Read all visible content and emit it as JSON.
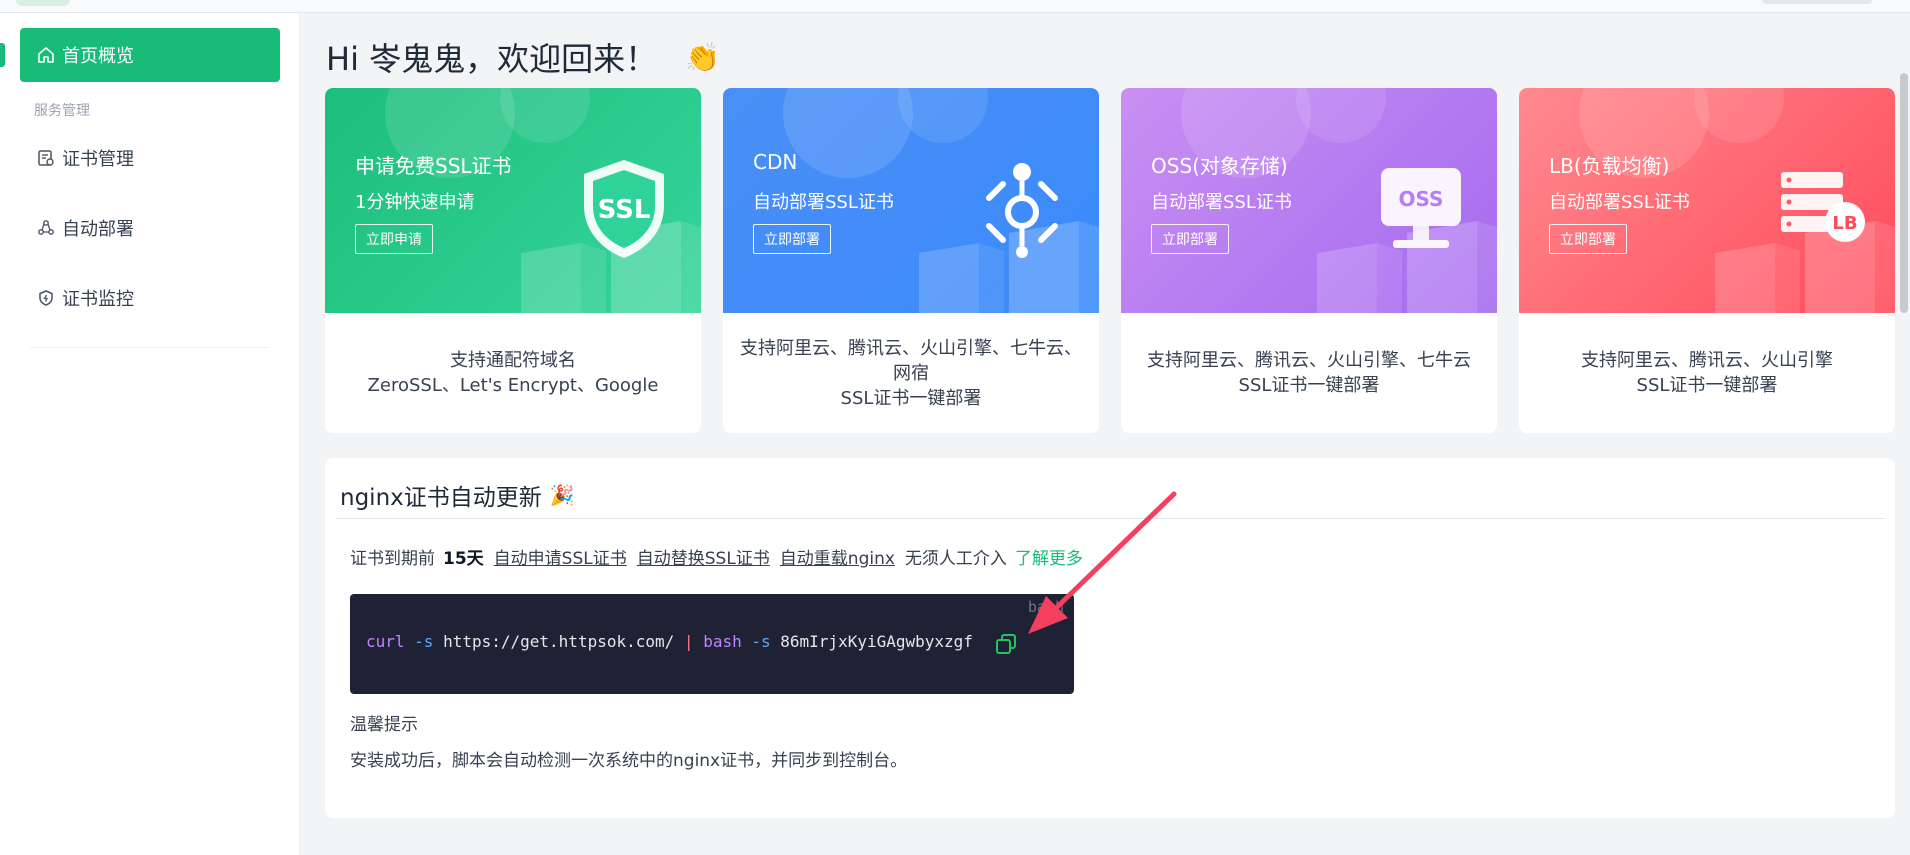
{
  "sidebar": {
    "items": [
      {
        "label": "首页概览",
        "icon": "home-icon",
        "active": true
      },
      {
        "label": "证书管理",
        "icon": "certificate-icon"
      },
      {
        "label": "自动部署",
        "icon": "deploy-icon"
      },
      {
        "label": "证书监控",
        "icon": "shield-icon"
      }
    ],
    "section_label": "服务管理"
  },
  "greeting": {
    "text": "Hi 岺鬼鬼，欢迎回来！",
    "emoji": "👏"
  },
  "cards": [
    {
      "title": "申请免费SSL证书",
      "subtitle": "1分钟快速申请",
      "button": "立即申请",
      "desc": [
        "支持通配符域名",
        "ZeroSSL、Let's Encrypt、Google"
      ],
      "illus_label": "SSL",
      "icon": "ssl-shield-icon"
    },
    {
      "title": "CDN",
      "subtitle": "自动部署SSL证书",
      "button": "立即部署",
      "desc": [
        "支持阿里云、腾讯云、火山引擎、七牛云、",
        "网宿",
        "SSL证书一键部署"
      ],
      "icon": "cdn-network-icon"
    },
    {
      "title": "OSS(对象存储)",
      "subtitle": "自动部署SSL证书",
      "button": "立即部署",
      "desc": [
        "支持阿里云、腾讯云、火山引擎、七牛云",
        "SSL证书一键部署"
      ],
      "illus_label": "OSS",
      "icon": "oss-monitor-icon"
    },
    {
      "title": "LB(负载均衡)",
      "subtitle": "自动部署SSL证书",
      "button": "立即部署",
      "desc": [
        "支持阿里云、腾讯云、火山引擎",
        "SSL证书一键部署"
      ],
      "illus_label": "LB",
      "icon": "lb-server-icon"
    }
  ],
  "panel": {
    "title": "nginx证书自动更新",
    "title_emoji": "🎉",
    "info": {
      "prefix": "证书到期前",
      "days": "15天",
      "steps": [
        "自动申请SSL证书",
        "自动替换SSL证书",
        "自动重载nginx"
      ],
      "suffix": "无须人工介入",
      "more_link": "了解更多"
    },
    "code": {
      "lang": "bash",
      "cmd": "curl",
      "flag1": "-s",
      "url": "https://get.httpsok.com/",
      "pipe": "|",
      "cmd2": "bash",
      "flag2": "-s",
      "token": "86mIrjxKyiGAgwbyxzgf"
    },
    "tip_title": "温馨提示",
    "tip_body": "安装成功后，脚本会自动检测一次系统中的nginx证书，并同步到控制台。"
  },
  "colors": {
    "primary": "#18bc78",
    "card_green": "#1dbe7b",
    "card_blue": "#3a8afc",
    "card_purple": "#a56af0",
    "card_red": "#ff4a5a",
    "code_bg": "#1f2235",
    "arrow": "#f43f5e"
  }
}
